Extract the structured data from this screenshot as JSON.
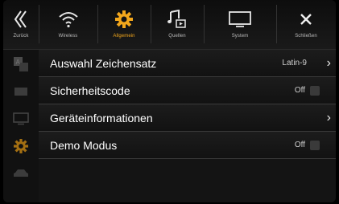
{
  "topbar": {
    "back_label": "Zurück",
    "wireless_label": "Wireless",
    "allgemein_label": "Allgemein",
    "quellen_label": "Quellen",
    "system_label": "System",
    "close_label": "Schließen"
  },
  "colors": {
    "accent": "#f2a71c"
  },
  "rows": [
    {
      "label": "Auswahl Zeichensatz",
      "value": "Latin-9"
    },
    {
      "label": "Sicherheitscode",
      "value": "Off"
    },
    {
      "label": "Geräteinformationen",
      "value": ""
    },
    {
      "label": "Demo Modus",
      "value": "Off"
    }
  ],
  "left_icons": [
    "language-icon",
    "display-icon",
    "screen-icon",
    "gear-icon",
    "car-icon"
  ]
}
